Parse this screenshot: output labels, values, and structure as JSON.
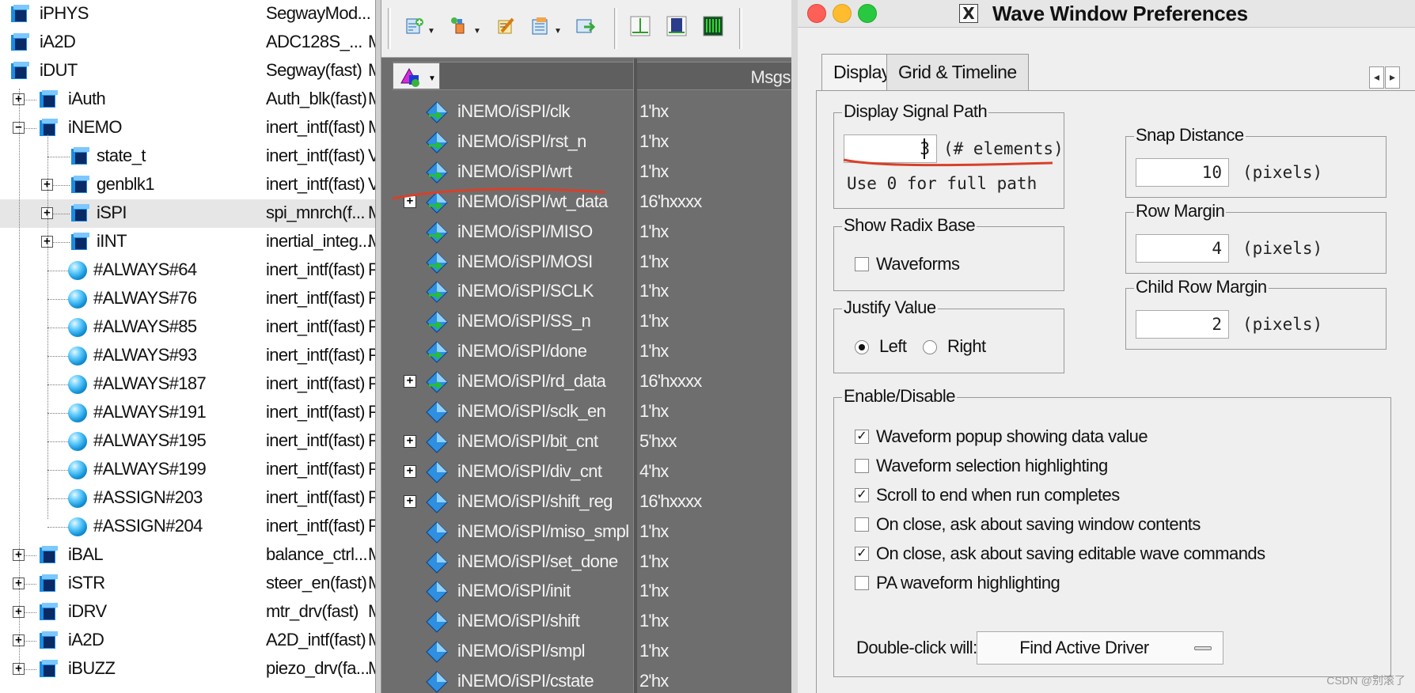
{
  "hierarchy": {
    "rows": [
      {
        "name": "iPHYS",
        "type": "SegwayMod...",
        "trail": "",
        "expander": "none",
        "icon": "square"
      },
      {
        "name": "iA2D",
        "type": "ADC128S_...",
        "trail": "M",
        "expander": "none",
        "icon": "square"
      },
      {
        "name": "iDUT",
        "type": "Segway(fast)",
        "trail": "M",
        "expander": "none",
        "icon": "square"
      },
      {
        "name": "iAuth",
        "type": "Auth_blk(fast)",
        "trail": "M",
        "expander": "+",
        "icon": "square"
      },
      {
        "name": "iNEMO",
        "type": "inert_intf(fast)",
        "trail": "M",
        "expander": "-",
        "icon": "square"
      },
      {
        "name": "state_t",
        "type": "inert_intf(fast)",
        "trail": "V",
        "expander": "none",
        "icon": "square"
      },
      {
        "name": "genblk1",
        "type": "inert_intf(fast)",
        "trail": "V",
        "expander": "+",
        "icon": "square"
      },
      {
        "name": "iSPI",
        "type": "spi_mnrch(f...",
        "trail": "M",
        "expander": "+",
        "icon": "square"
      },
      {
        "name": "iINT",
        "type": "inertial_integ...",
        "trail": "M",
        "expander": "+",
        "icon": "square"
      },
      {
        "name": "#ALWAYS#64",
        "type": "inert_intf(fast)",
        "trail": "P",
        "expander": "none",
        "icon": "ball"
      },
      {
        "name": "#ALWAYS#76",
        "type": "inert_intf(fast)",
        "trail": "P",
        "expander": "none",
        "icon": "ball"
      },
      {
        "name": "#ALWAYS#85",
        "type": "inert_intf(fast)",
        "trail": "P",
        "expander": "none",
        "icon": "ball"
      },
      {
        "name": "#ALWAYS#93",
        "type": "inert_intf(fast)",
        "trail": "P",
        "expander": "none",
        "icon": "ball"
      },
      {
        "name": "#ALWAYS#187",
        "type": "inert_intf(fast)",
        "trail": "P",
        "expander": "none",
        "icon": "ball"
      },
      {
        "name": "#ALWAYS#191",
        "type": "inert_intf(fast)",
        "trail": "P",
        "expander": "none",
        "icon": "ball"
      },
      {
        "name": "#ALWAYS#195",
        "type": "inert_intf(fast)",
        "trail": "P",
        "expander": "none",
        "icon": "ball"
      },
      {
        "name": "#ALWAYS#199",
        "type": "inert_intf(fast)",
        "trail": "P",
        "expander": "none",
        "icon": "ball"
      },
      {
        "name": "#ASSIGN#203",
        "type": "inert_intf(fast)",
        "trail": "P",
        "expander": "none",
        "icon": "ball"
      },
      {
        "name": "#ASSIGN#204",
        "type": "inert_intf(fast)",
        "trail": "P",
        "expander": "none",
        "icon": "ball"
      },
      {
        "name": "iBAL",
        "type": "balance_ctrl...",
        "trail": "M",
        "expander": "+",
        "icon": "square"
      },
      {
        "name": "iSTR",
        "type": "steer_en(fast)",
        "trail": "M",
        "expander": "+",
        "icon": "square"
      },
      {
        "name": "iDRV",
        "type": "mtr_drv(fast)",
        "trail": "M",
        "expander": "+",
        "icon": "square"
      },
      {
        "name": "iA2D",
        "type": "A2D_intf(fast)",
        "trail": "M",
        "expander": "+",
        "icon": "square"
      },
      {
        "name": "iBUZZ",
        "type": "piezo_drv(fa...",
        "trail": "M",
        "expander": "+",
        "icon": "square"
      }
    ]
  },
  "wave": {
    "toolbar_icons": [
      "add-wave-icon",
      "add-dataflow-icon",
      "edit-icon",
      "add-list-icon",
      "add-memory-icon",
      "cursor-icon",
      "zoom-full-icon",
      "zoom-in-icon"
    ],
    "msgs_header": "Msgs",
    "signals": [
      {
        "name": "iNEMO/iSPI/clk",
        "value": "1'hx",
        "expander": false
      },
      {
        "name": "iNEMO/iSPI/rst_n",
        "value": "1'hx",
        "expander": false
      },
      {
        "name": "iNEMO/iSPI/wrt",
        "value": "1'hx",
        "expander": false
      },
      {
        "name": "iNEMO/iSPI/wt_data",
        "value": "16'hxxxx",
        "expander": true
      },
      {
        "name": "iNEMO/iSPI/MISO",
        "value": "1'hx",
        "expander": false
      },
      {
        "name": "iNEMO/iSPI/MOSI",
        "value": "1'hx",
        "expander": false
      },
      {
        "name": "iNEMO/iSPI/SCLK",
        "value": "1'hx",
        "expander": false
      },
      {
        "name": "iNEMO/iSPI/SS_n",
        "value": "1'hx",
        "expander": false
      },
      {
        "name": "iNEMO/iSPI/done",
        "value": "1'hx",
        "expander": false
      },
      {
        "name": "iNEMO/iSPI/rd_data",
        "value": "16'hxxxx",
        "expander": true
      },
      {
        "name": "iNEMO/iSPI/sclk_en",
        "value": "1'hx",
        "expander": false
      },
      {
        "name": "iNEMO/iSPI/bit_cnt",
        "value": "5'hxx",
        "expander": true
      },
      {
        "name": "iNEMO/iSPI/div_cnt",
        "value": "4'hx",
        "expander": true
      },
      {
        "name": "iNEMO/iSPI/shift_reg",
        "value": "16'hxxxx",
        "expander": true
      },
      {
        "name": "iNEMO/iSPI/miso_smpl",
        "value": "1'hx",
        "expander": false
      },
      {
        "name": "iNEMO/iSPI/set_done",
        "value": "1'hx",
        "expander": false
      },
      {
        "name": "iNEMO/iSPI/init",
        "value": "1'hx",
        "expander": false
      },
      {
        "name": "iNEMO/iSPI/shift",
        "value": "1'hx",
        "expander": false
      },
      {
        "name": "iNEMO/iSPI/smpl",
        "value": "1'hx",
        "expander": false
      },
      {
        "name": "iNEMO/iSPI/cstate",
        "value": "2'hx",
        "expander": false
      }
    ]
  },
  "prefs": {
    "title": "Wave Window Preferences",
    "tabs": [
      "Display",
      "Grid & Timeline"
    ],
    "display_signal_path": {
      "legend": "Display Signal Path",
      "value": "3",
      "unit": "(# elements)",
      "hint": "Use 0 for full path"
    },
    "show_radix": {
      "legend": "Show Radix Base",
      "option": "Waveforms",
      "checked": false
    },
    "justify": {
      "legend": "Justify Value",
      "left": "Left",
      "right": "Right",
      "selected": "Left"
    },
    "snap": {
      "legend": "Snap Distance",
      "value": "10",
      "unit": "(pixels)"
    },
    "row_margin": {
      "legend": "Row Margin",
      "value": "4",
      "unit": "(pixels)"
    },
    "child_row_margin": {
      "legend": "Child Row Margin",
      "value": "2",
      "unit": "(pixels)"
    },
    "enable": {
      "legend": "Enable/Disable",
      "options": [
        {
          "label": "Waveform popup showing data value",
          "checked": true
        },
        {
          "label": "Waveform selection highlighting",
          "checked": false
        },
        {
          "label": "Scroll to end when run completes",
          "checked": true
        },
        {
          "label": "On close, ask about saving window contents",
          "checked": false
        },
        {
          "label": "On close, ask about saving editable wave commands",
          "checked": true
        },
        {
          "label": "PA waveform highlighting",
          "checked": false
        }
      ],
      "double_click_label": "Double-click will:",
      "double_click_value": "Find Active Driver"
    },
    "colors": {
      "close": "#fe5f57",
      "minimize": "#febc2e",
      "zoom": "#28c840",
      "annotation": "#d8402a"
    }
  },
  "watermark": "CSDN @别滚了"
}
